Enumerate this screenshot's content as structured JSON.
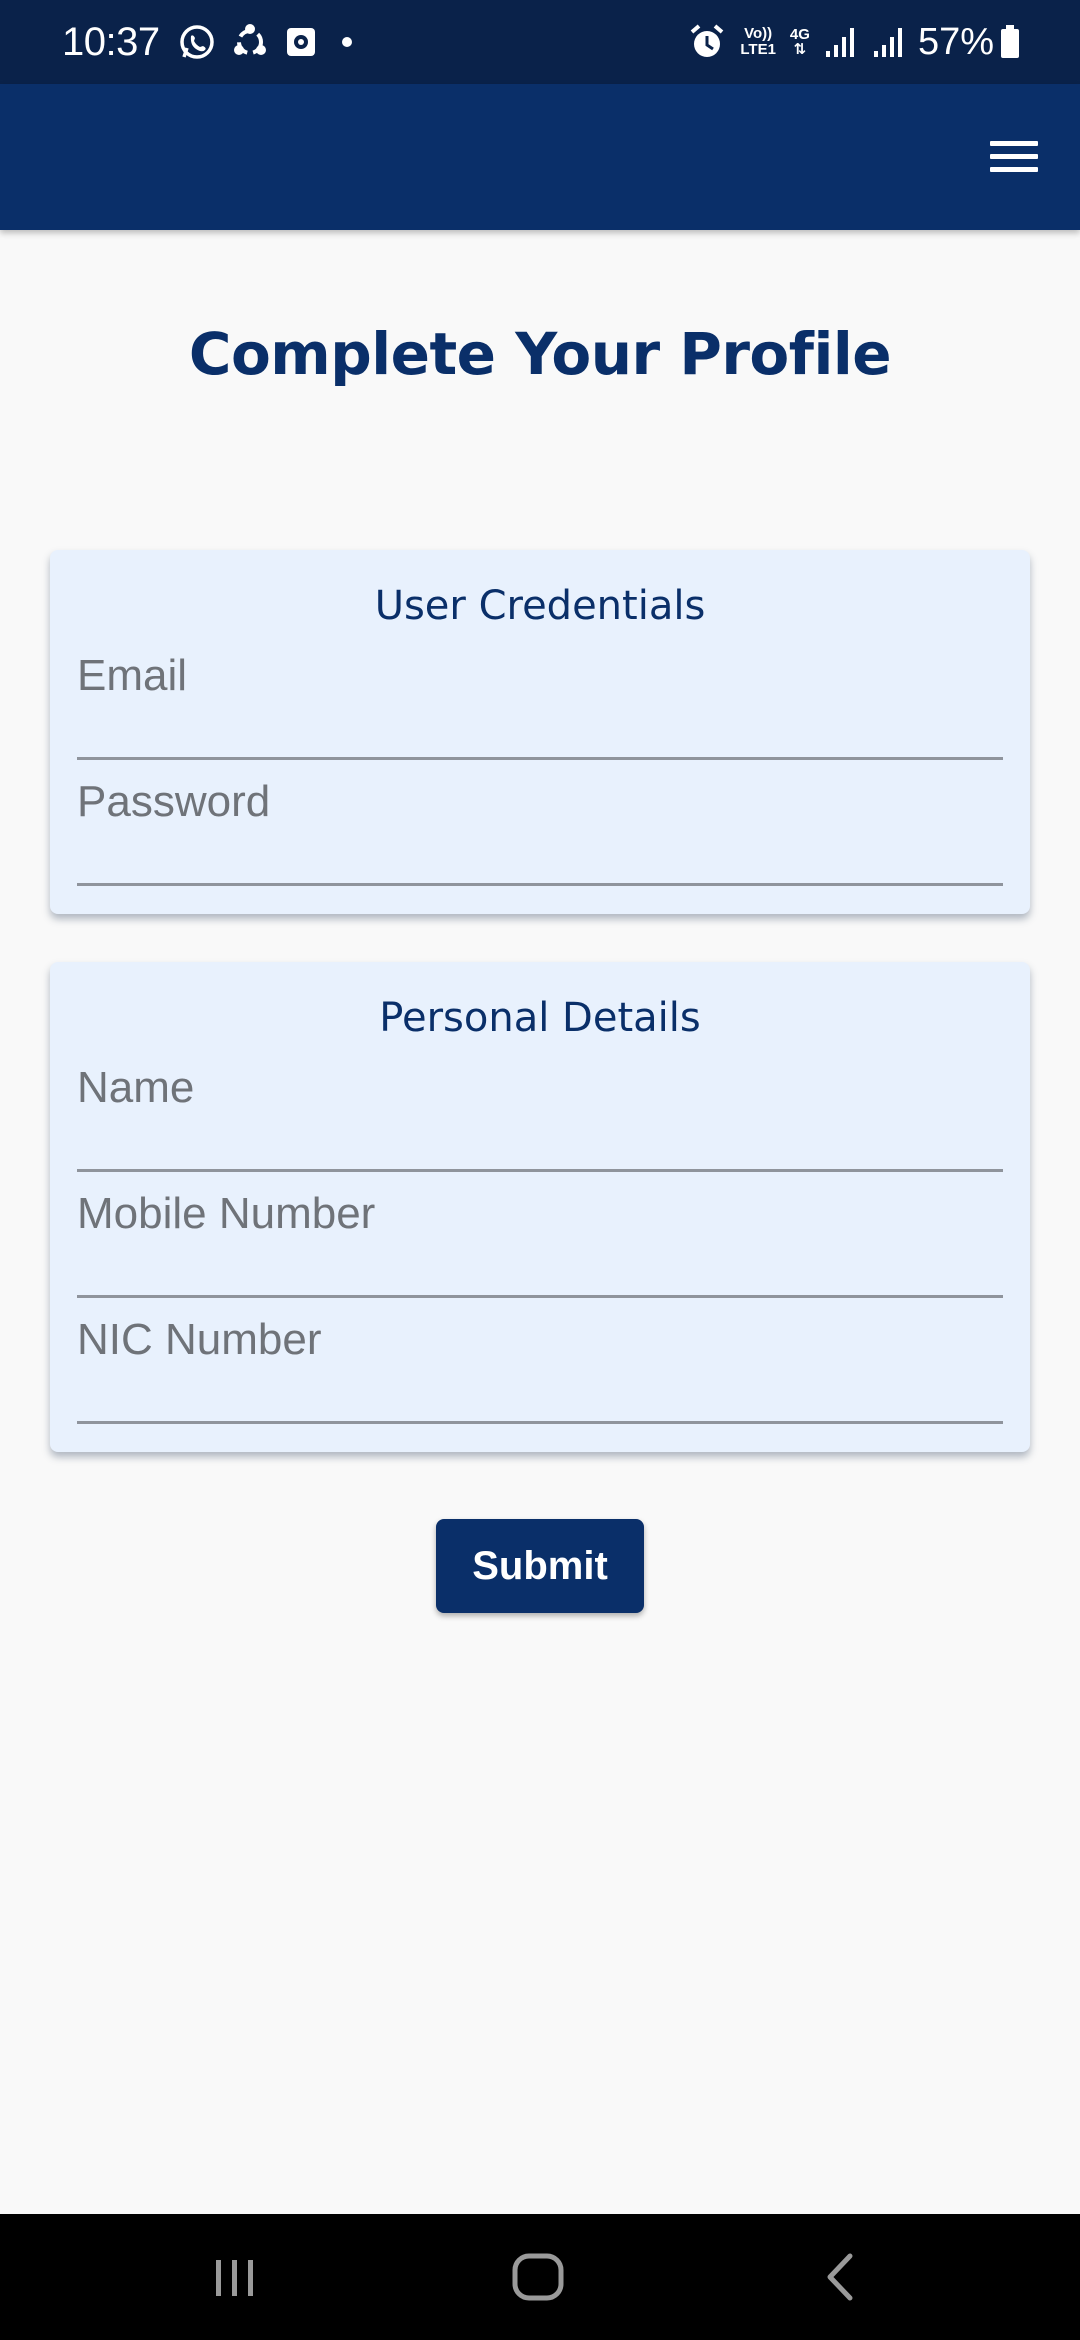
{
  "status_bar": {
    "time": "10:37",
    "battery": "57%",
    "icons": [
      "whatsapp-icon",
      "share-icon",
      "screen-record-icon",
      "alarm-icon",
      "volte-icon",
      "4g-icon",
      "signal-icon",
      "signal-icon",
      "battery-icon"
    ],
    "volte_label_top": "Vo))",
    "volte_label_bottom": "LTE1",
    "network_label": "4G"
  },
  "app_bar": {
    "menu_icon": "menu-icon",
    "color": "#0a2f69"
  },
  "page": {
    "title": "Complete Your Profile"
  },
  "credentials": {
    "heading": "User Credentials",
    "email_placeholder": "Email",
    "password_placeholder": "Password"
  },
  "personal": {
    "heading": "Personal Details",
    "name_placeholder": "Name",
    "mobile_placeholder": "Mobile Number",
    "nic_placeholder": "NIC Number"
  },
  "submit": {
    "label": "Submit"
  },
  "nav_bar": {
    "icons": [
      "recents-icon",
      "home-icon",
      "back-icon"
    ]
  },
  "colors": {
    "primary": "#0a2f69",
    "status_bar": "#0a224a",
    "card_background": "#e8f1fd",
    "page_background": "#f9f9f9"
  }
}
